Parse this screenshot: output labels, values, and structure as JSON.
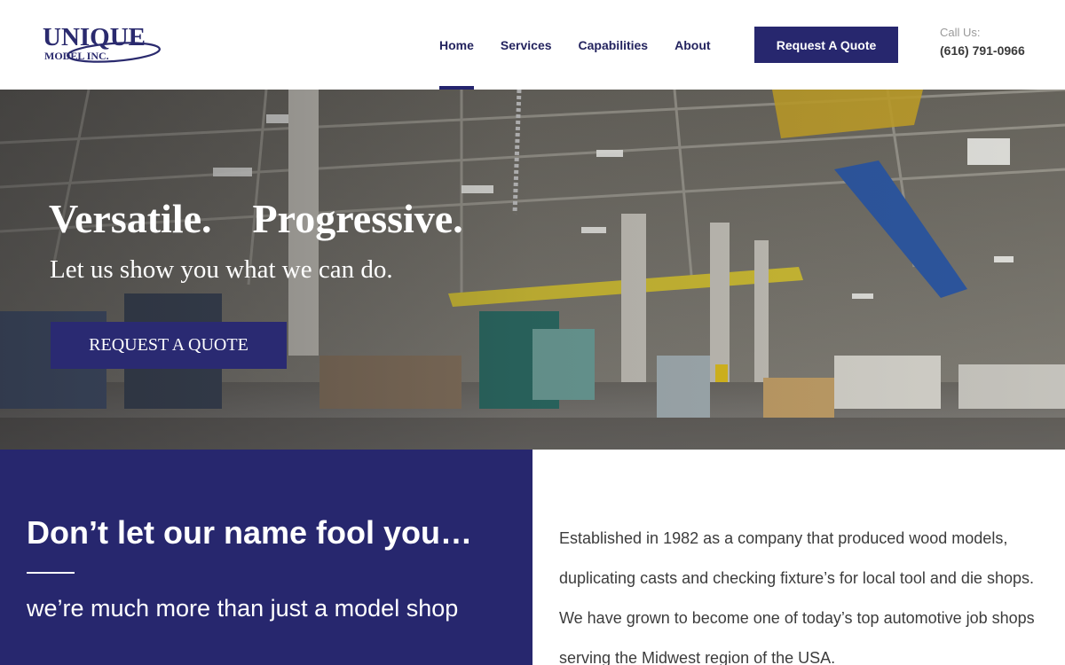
{
  "header": {
    "logo_main": "UNIQUE",
    "logo_sub": "MODEL INC.",
    "nav": [
      {
        "label": "Home",
        "active": true
      },
      {
        "label": "Services",
        "active": false
      },
      {
        "label": "Capabilities",
        "active": false
      },
      {
        "label": "About",
        "active": false
      }
    ],
    "quote_button": "Request A Quote",
    "call_label": "Call Us:",
    "phone": "(616) 791-0966"
  },
  "hero": {
    "title_word_1": "Versatile.",
    "title_word_2": "Progressive.",
    "subtitle": "Let us show you what we can do.",
    "button": "REQUEST A QUOTE"
  },
  "intro": {
    "heading": "Don’t let our name fool you…",
    "subheading": "we’re much more than just a model shop",
    "paragraph": "Established in 1982 as a company that produced wood models, duplicating casts and checking fixture’s for local tool and die shops. We have grown to become one of today’s top automotive job shops serving the Midwest region of the USA."
  },
  "colors": {
    "brand_navy": "#27276e",
    "nav_text": "#24245f",
    "white": "#ffffff"
  }
}
